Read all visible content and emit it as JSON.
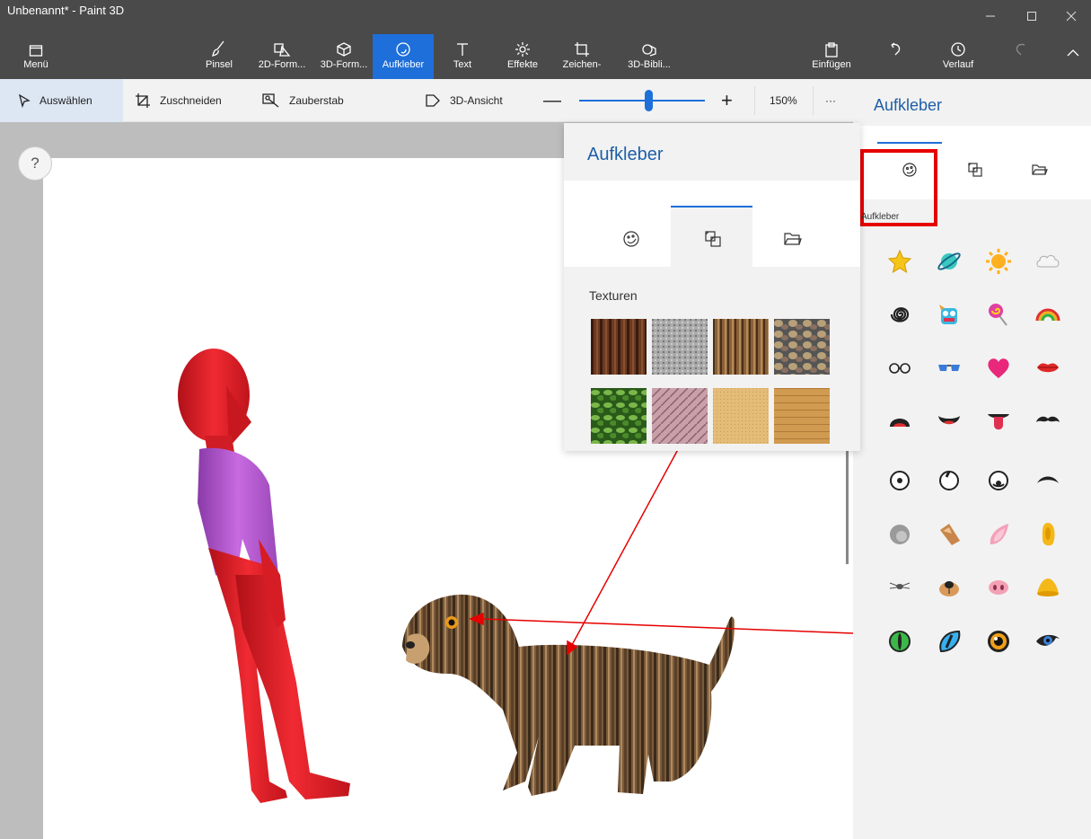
{
  "window": {
    "title": "Unbenannt* - Paint 3D"
  },
  "ribbon": {
    "menu": "Menü",
    "brushes": "Pinsel",
    "shapes2d": "2D-Form...",
    "shapes3d": "3D-Form...",
    "stickers": "Aufkleber",
    "text": "Text",
    "effects": "Effekte",
    "canvas": "Zeichen-",
    "library3d": "3D-Bibli...",
    "paste": "Einfügen",
    "history": "Verlauf"
  },
  "toolbar": {
    "select": "Auswählen",
    "crop": "Zuschneiden",
    "magic": "Zauberstab",
    "view3d": "3D-Ansicht",
    "zoom": "150%",
    "more": "···"
  },
  "zoom_level": 0.55,
  "help": "?",
  "right_panel": {
    "title": "Aufkleber",
    "section_label": "Aufkleber",
    "stickers": [
      "star-sticker",
      "planet-sticker",
      "sun-sticker",
      "cloud-sticker",
      "spiral-sticker",
      "monster-sticker",
      "lollipop-sticker",
      "rainbow-sticker",
      "glasses-sticker",
      "sunglasses-sticker",
      "heart-sticker",
      "lips-sticker",
      "open-mouth-sticker",
      "grin-mouth-sticker",
      "tongue-mouth-sticker",
      "mustache-sticker",
      "eye-center-sticker",
      "eye-up-sticker",
      "eye-down-sticker",
      "eyebrow-sticker",
      "grey-ear-sticker",
      "dog-ear-sticker",
      "pink-ear-sticker",
      "yellow-ear-sticker",
      "fly-nose-sticker",
      "dog-nose-sticker",
      "pig-nose-sticker",
      "duck-beak-sticker",
      "cat-eye-green-sticker",
      "cat-eye-blue-sticker",
      "dog-eye-sticker",
      "human-eye-sticker"
    ]
  },
  "popup": {
    "title": "Aufkleber",
    "section_label": "Texturen",
    "textures": [
      "bark",
      "granite",
      "hair",
      "pebbles",
      "leaves",
      "marble",
      "sand",
      "wood"
    ]
  },
  "colors": {
    "accent": "#1e6fd9",
    "highlight_box": "#e60000",
    "figure": "#e8262e",
    "shirt": "#c05bd6",
    "annotation_arrow": "#e60000"
  }
}
